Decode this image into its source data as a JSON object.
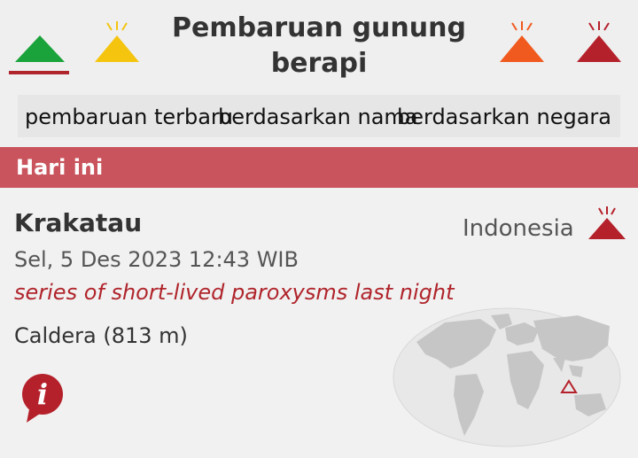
{
  "header": {
    "title": "Pembaruan gunung berapi",
    "levels": [
      {
        "name": "normal",
        "color": "#1aa33a",
        "selected": true
      },
      {
        "name": "advisory",
        "color": "#f4c40f"
      },
      {
        "name": "watch",
        "color": "#f05a1e"
      },
      {
        "name": "warning",
        "color": "#b5212b"
      }
    ]
  },
  "tabs": [
    "pembaruan terbaru",
    "berdasarkan nama",
    "berdasarkan negara"
  ],
  "section": {
    "label": "Hari ini"
  },
  "volcano": {
    "name": "Krakatau",
    "datetime": "Sel, 5 Des 2023 12:43 WIB",
    "note": "series of short-lived paroxysms last night",
    "type": "Caldera (813 m)",
    "country": "Indonesia",
    "alert_color": "#b5212b",
    "icons": {
      "alert": "erupting-volcano-icon",
      "info": "info-icon",
      "map": "world-map-icon"
    }
  }
}
